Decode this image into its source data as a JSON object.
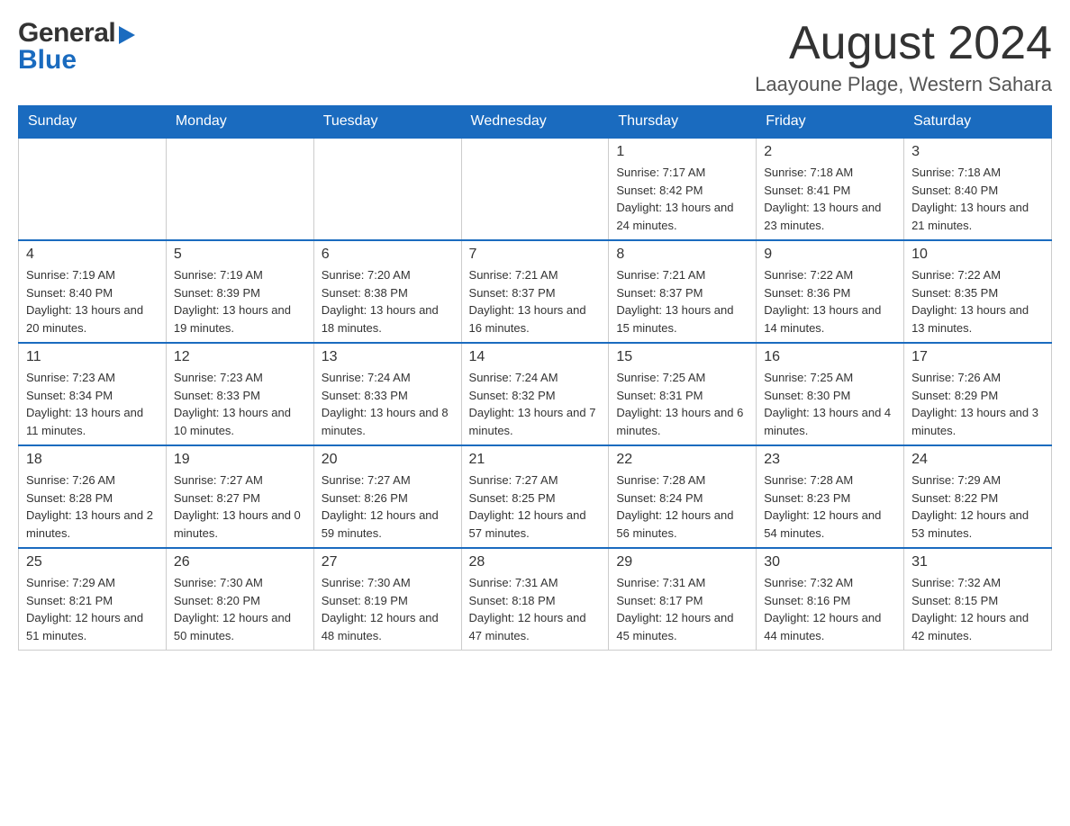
{
  "header": {
    "logo_general": "General",
    "logo_blue": "Blue",
    "month_title": "August 2024",
    "location": "Laayoune Plage, Western Sahara"
  },
  "days_of_week": [
    "Sunday",
    "Monday",
    "Tuesday",
    "Wednesday",
    "Thursday",
    "Friday",
    "Saturday"
  ],
  "weeks": [
    {
      "days": [
        {
          "number": "",
          "info": ""
        },
        {
          "number": "",
          "info": ""
        },
        {
          "number": "",
          "info": ""
        },
        {
          "number": "",
          "info": ""
        },
        {
          "number": "1",
          "info": "Sunrise: 7:17 AM\nSunset: 8:42 PM\nDaylight: 13 hours and 24 minutes."
        },
        {
          "number": "2",
          "info": "Sunrise: 7:18 AM\nSunset: 8:41 PM\nDaylight: 13 hours and 23 minutes."
        },
        {
          "number": "3",
          "info": "Sunrise: 7:18 AM\nSunset: 8:40 PM\nDaylight: 13 hours and 21 minutes."
        }
      ]
    },
    {
      "days": [
        {
          "number": "4",
          "info": "Sunrise: 7:19 AM\nSunset: 8:40 PM\nDaylight: 13 hours and 20 minutes."
        },
        {
          "number": "5",
          "info": "Sunrise: 7:19 AM\nSunset: 8:39 PM\nDaylight: 13 hours and 19 minutes."
        },
        {
          "number": "6",
          "info": "Sunrise: 7:20 AM\nSunset: 8:38 PM\nDaylight: 13 hours and 18 minutes."
        },
        {
          "number": "7",
          "info": "Sunrise: 7:21 AM\nSunset: 8:37 PM\nDaylight: 13 hours and 16 minutes."
        },
        {
          "number": "8",
          "info": "Sunrise: 7:21 AM\nSunset: 8:37 PM\nDaylight: 13 hours and 15 minutes."
        },
        {
          "number": "9",
          "info": "Sunrise: 7:22 AM\nSunset: 8:36 PM\nDaylight: 13 hours and 14 minutes."
        },
        {
          "number": "10",
          "info": "Sunrise: 7:22 AM\nSunset: 8:35 PM\nDaylight: 13 hours and 13 minutes."
        }
      ]
    },
    {
      "days": [
        {
          "number": "11",
          "info": "Sunrise: 7:23 AM\nSunset: 8:34 PM\nDaylight: 13 hours and 11 minutes."
        },
        {
          "number": "12",
          "info": "Sunrise: 7:23 AM\nSunset: 8:33 PM\nDaylight: 13 hours and 10 minutes."
        },
        {
          "number": "13",
          "info": "Sunrise: 7:24 AM\nSunset: 8:33 PM\nDaylight: 13 hours and 8 minutes."
        },
        {
          "number": "14",
          "info": "Sunrise: 7:24 AM\nSunset: 8:32 PM\nDaylight: 13 hours and 7 minutes."
        },
        {
          "number": "15",
          "info": "Sunrise: 7:25 AM\nSunset: 8:31 PM\nDaylight: 13 hours and 6 minutes."
        },
        {
          "number": "16",
          "info": "Sunrise: 7:25 AM\nSunset: 8:30 PM\nDaylight: 13 hours and 4 minutes."
        },
        {
          "number": "17",
          "info": "Sunrise: 7:26 AM\nSunset: 8:29 PM\nDaylight: 13 hours and 3 minutes."
        }
      ]
    },
    {
      "days": [
        {
          "number": "18",
          "info": "Sunrise: 7:26 AM\nSunset: 8:28 PM\nDaylight: 13 hours and 2 minutes."
        },
        {
          "number": "19",
          "info": "Sunrise: 7:27 AM\nSunset: 8:27 PM\nDaylight: 13 hours and 0 minutes."
        },
        {
          "number": "20",
          "info": "Sunrise: 7:27 AM\nSunset: 8:26 PM\nDaylight: 12 hours and 59 minutes."
        },
        {
          "number": "21",
          "info": "Sunrise: 7:27 AM\nSunset: 8:25 PM\nDaylight: 12 hours and 57 minutes."
        },
        {
          "number": "22",
          "info": "Sunrise: 7:28 AM\nSunset: 8:24 PM\nDaylight: 12 hours and 56 minutes."
        },
        {
          "number": "23",
          "info": "Sunrise: 7:28 AM\nSunset: 8:23 PM\nDaylight: 12 hours and 54 minutes."
        },
        {
          "number": "24",
          "info": "Sunrise: 7:29 AM\nSunset: 8:22 PM\nDaylight: 12 hours and 53 minutes."
        }
      ]
    },
    {
      "days": [
        {
          "number": "25",
          "info": "Sunrise: 7:29 AM\nSunset: 8:21 PM\nDaylight: 12 hours and 51 minutes."
        },
        {
          "number": "26",
          "info": "Sunrise: 7:30 AM\nSunset: 8:20 PM\nDaylight: 12 hours and 50 minutes."
        },
        {
          "number": "27",
          "info": "Sunrise: 7:30 AM\nSunset: 8:19 PM\nDaylight: 12 hours and 48 minutes."
        },
        {
          "number": "28",
          "info": "Sunrise: 7:31 AM\nSunset: 8:18 PM\nDaylight: 12 hours and 47 minutes."
        },
        {
          "number": "29",
          "info": "Sunrise: 7:31 AM\nSunset: 8:17 PM\nDaylight: 12 hours and 45 minutes."
        },
        {
          "number": "30",
          "info": "Sunrise: 7:32 AM\nSunset: 8:16 PM\nDaylight: 12 hours and 44 minutes."
        },
        {
          "number": "31",
          "info": "Sunrise: 7:32 AM\nSunset: 8:15 PM\nDaylight: 12 hours and 42 minutes."
        }
      ]
    }
  ]
}
